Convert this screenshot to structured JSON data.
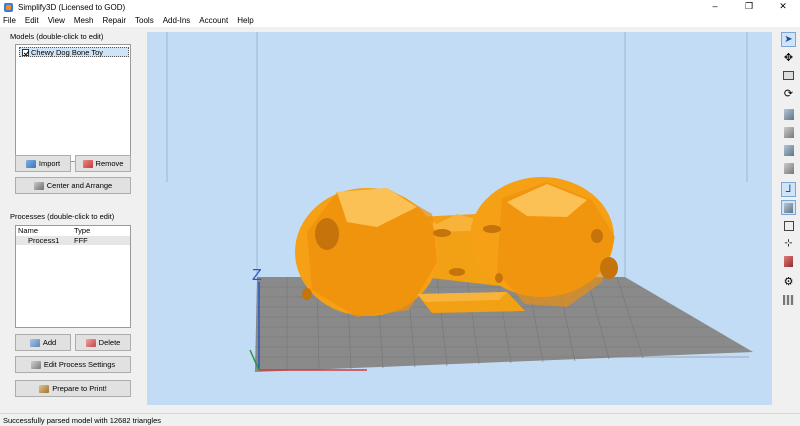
{
  "window": {
    "title": "Simplify3D (Licensed to GOD)",
    "minimize": "–",
    "maximize": "❐",
    "close": "✕"
  },
  "menu": [
    "File",
    "Edit",
    "View",
    "Mesh",
    "Repair",
    "Tools",
    "Add-Ins",
    "Account",
    "Help"
  ],
  "models": {
    "label": "Models (double-click to edit)",
    "items": [
      {
        "name": "Chewy Dog Bone Toy",
        "checked": true
      }
    ],
    "import_label": "Import",
    "remove_label": "Remove",
    "center_label": "Center and Arrange"
  },
  "processes": {
    "label": "Processes (double-click to edit)",
    "columns": [
      "Name",
      "Type"
    ],
    "rows": [
      {
        "name": "Process1",
        "type": "FFF"
      }
    ],
    "add_label": "Add",
    "delete_label": "Delete",
    "edit_label": "Edit Process Settings",
    "prepare_label": "Prepare to Print!"
  },
  "viewport": {
    "axis_label": "Z",
    "model_color": "#f5a015",
    "bed_color": "#8a8a8a",
    "bg_color": "#c2dcf5"
  },
  "tools": [
    "select-icon",
    "move-icon",
    "scale-icon",
    "rotate-icon",
    "view-default-icon",
    "view-front-icon",
    "view-top-icon",
    "view-left-icon",
    "axes-icon",
    "cube-view-icon",
    "cross-section-icon",
    "measure-icon",
    "preview-icon",
    "settings-icon",
    "support-icon"
  ],
  "status": {
    "text": "Successfully parsed model with 12682 triangles"
  }
}
